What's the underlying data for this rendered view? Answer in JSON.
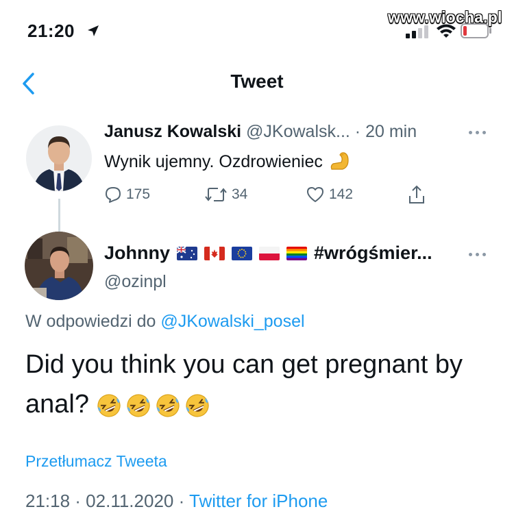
{
  "status_bar": {
    "time": "21:20",
    "watermark": "www.wiocha.pl",
    "battery_color": "#e0383e"
  },
  "nav": {
    "title": "Tweet"
  },
  "parent_tweet": {
    "author_name": "Janusz Kowalski",
    "handle": "@JKowalsk...",
    "separator": "·",
    "time": "20 min",
    "text": "Wynik ujemny. Ozdrowieniec",
    "emoji": "flexed-biceps",
    "replies": "175",
    "retweets": "34",
    "likes": "142"
  },
  "main_tweet": {
    "author_name": "Johnny",
    "name_flags": [
      "australia-flag",
      "canada-flag",
      "eu-flag",
      "poland-flag",
      "rainbow-flag"
    ],
    "name_suffix": "#wrógśmier...",
    "handle": "@ozinpl",
    "reply_prefix": "W odpowiedzi do",
    "reply_to": "@JKowalski_posel",
    "body": "Did you think you can get pregnant by anal?",
    "body_emojis": [
      "rolling-on-floor-laughing",
      "rolling-on-floor-laughing",
      "rolling-on-floor-laughing",
      "rolling-on-floor-laughing"
    ],
    "translate_label": "Przetłumacz Tweeta",
    "meta_time": "21:18 · 02.11.2020 ·",
    "meta_source": "Twitter for iPhone"
  },
  "colors": {
    "accent": "#1d9bf0",
    "secondary_text": "#536471",
    "thread_line": "#cfd9de"
  }
}
